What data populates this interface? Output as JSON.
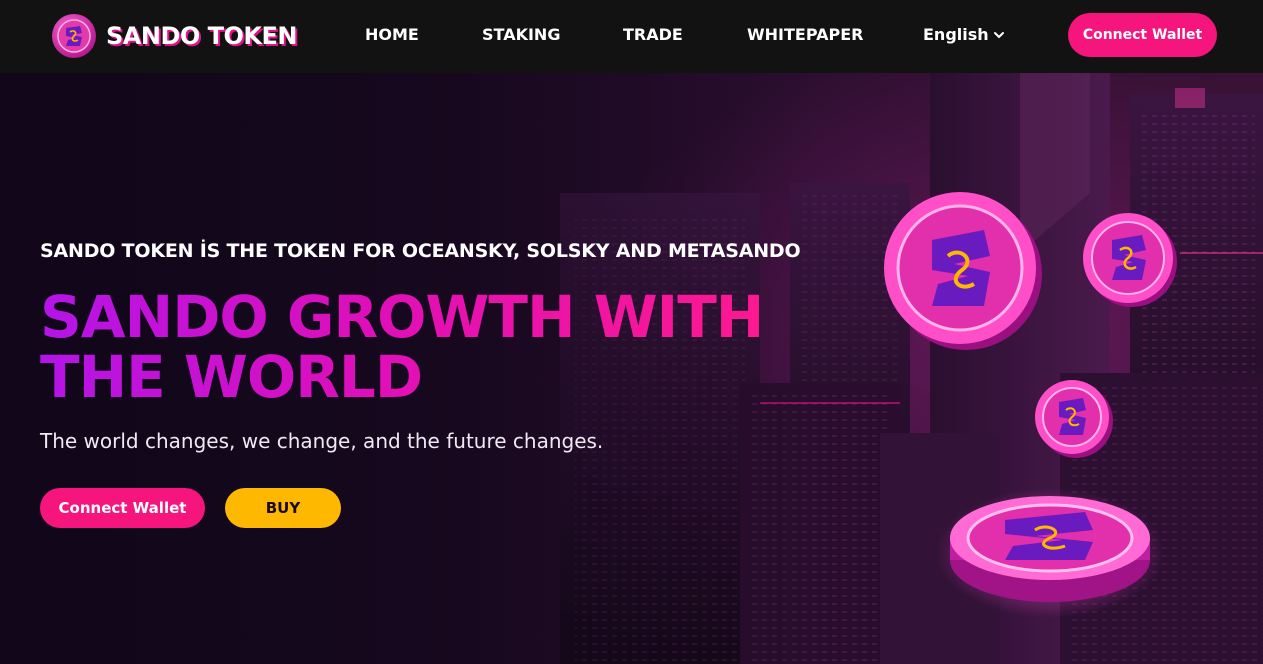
{
  "header": {
    "brand": "SANDO TOKEN",
    "nav": {
      "home": "HOME",
      "staking": "STAKING",
      "trade": "TRADE",
      "whitepaper": "WHITEPAPER"
    },
    "language": "English",
    "connect_label": "Connect Wallet"
  },
  "hero": {
    "subtitle": "SANDO TOKEN İS THE TOKEN FOR OCEANSKY, SOLSKY AND METASANDO",
    "headline_line1": "SANDO GROWTH WITH",
    "headline_line2": "THE WORLD",
    "tagline": "The world changes, we change, and the future changes.",
    "connect_label": "Connect Wallet",
    "buy_label": "BUY"
  },
  "colors": {
    "accent_pink": "#f5157d",
    "accent_purple": "#b414e8",
    "buy_yellow": "#ffb800",
    "header_bg": "#121212",
    "hero_bg": "#1a0a1f"
  },
  "icons": {
    "logo": "sando-logo-icon",
    "language_dropdown": "chevron-down-icon",
    "coins": "sando-coin-icon"
  }
}
